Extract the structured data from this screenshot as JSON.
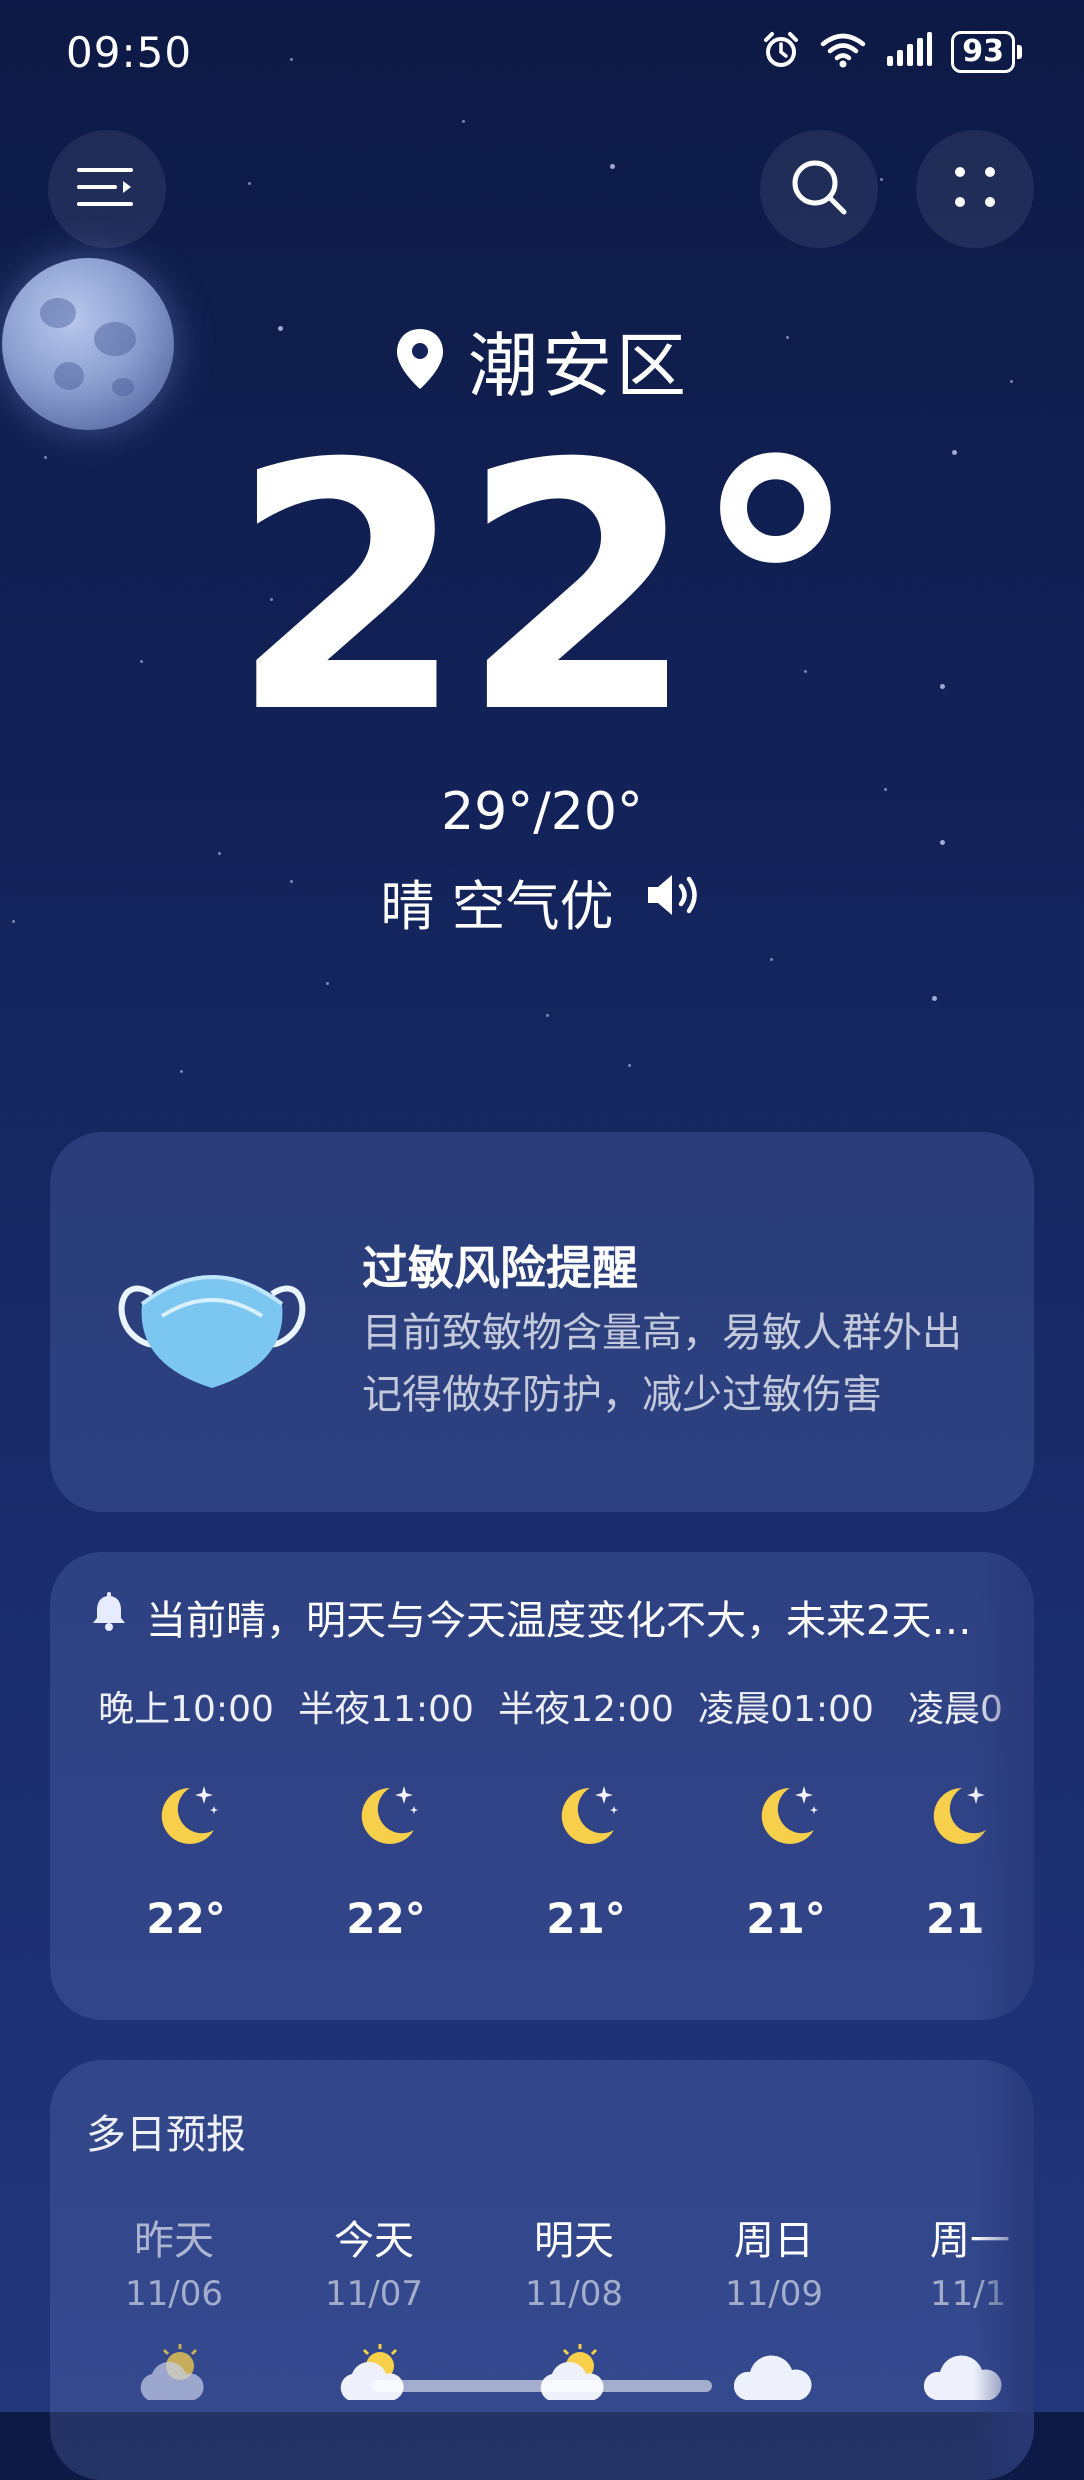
{
  "status_bar": {
    "time": "09:50",
    "battery": "93",
    "icons": [
      "alarm-icon",
      "wifi-icon",
      "signal-icon",
      "battery-icon"
    ]
  },
  "top_bar": {
    "menu_icon": "menu-icon",
    "search_icon": "search-icon",
    "more_icon": "grid-dots-icon"
  },
  "location": {
    "name": "潮安区",
    "icon": "location-pin-icon"
  },
  "current": {
    "temperature": "22°",
    "high_low": "29°/20°",
    "condition": "晴 空气优",
    "speaker_icon": "speaker-icon"
  },
  "allergy": {
    "title": "过敏风险提醒",
    "line1": "目前致敏物含量高，易敏人群外出",
    "line2": "记得做好防护，减少过敏伤害",
    "icon": "face-mask-icon"
  },
  "hourly": {
    "summary": "当前晴，明天与今天温度变化不大，未来2天…",
    "bell_icon": "bell-icon",
    "items": [
      {
        "time": "晚上10:00",
        "temp": "22°",
        "icon": "moon-stars-icon"
      },
      {
        "time": "半夜11:00",
        "temp": "22°",
        "icon": "moon-stars-icon"
      },
      {
        "time": "半夜12:00",
        "temp": "21°",
        "icon": "moon-stars-icon"
      },
      {
        "time": "凌晨01:00",
        "temp": "21°",
        "icon": "moon-stars-icon"
      },
      {
        "time": "凌晨0",
        "temp": "21",
        "icon": "moon-stars-icon"
      }
    ]
  },
  "daily": {
    "title": "多日预报",
    "items": [
      {
        "day": "昨天",
        "date": "11/06",
        "icon": "partly-cloudy-icon"
      },
      {
        "day": "今天",
        "date": "11/07",
        "icon": "partly-cloudy-icon"
      },
      {
        "day": "明天",
        "date": "11/08",
        "icon": "partly-cloudy-icon"
      },
      {
        "day": "周日",
        "date": "11/09",
        "icon": "cloud-icon"
      },
      {
        "day": "周一",
        "date": "11/1",
        "icon": "cloud-icon"
      }
    ]
  },
  "colors": {
    "background_top": "#0d1a45",
    "background_bottom": "#22367c",
    "moon_yellow": "#f7cf4a",
    "mask_blue": "#7cc7f2"
  }
}
